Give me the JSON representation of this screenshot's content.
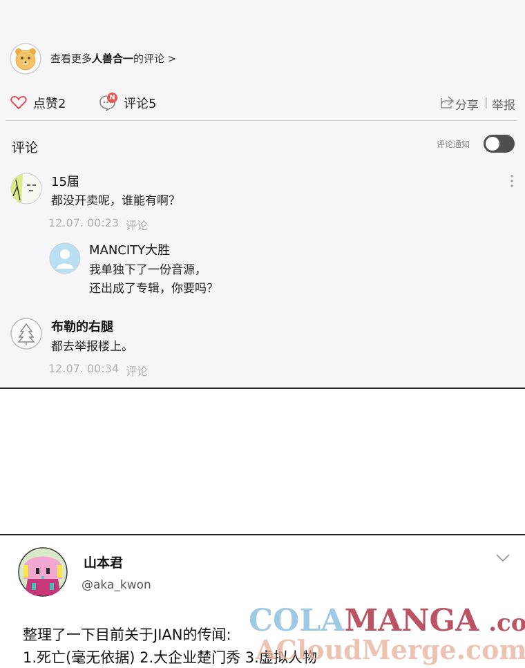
{
  "more_link": {
    "prefix": "查看更多",
    "bold": "人兽合一",
    "suffix": "的评论 >"
  },
  "actions": {
    "like_label": "点赞2",
    "comment_label": "评论5",
    "new_badge": "N",
    "share_label": "分享",
    "divider": "|",
    "report_label": "举报"
  },
  "comments_header": {
    "title": "评论",
    "notify_label": "评论通知"
  },
  "comments": [
    {
      "user": "15届",
      "text": "都没开卖呢，谁能有啊？",
      "time": "12.07. 00:23",
      "reply_label": "评论"
    },
    {
      "user": "布勒的右腿",
      "text": "都去举报楼上。",
      "time": "12.07. 00:34",
      "reply_label": "评论"
    }
  ],
  "reply": {
    "user": "MANCITY大胜",
    "line1": "我单独下了一份音源，",
    "line2": "还出成了专辑，你要吗？"
  },
  "tweet": {
    "name": "山本君",
    "handle": "@aka_kwon",
    "line1": "整理了一下目前关于JIAN的传闻:",
    "line2": "1.死亡(毫无依据) 2.大企业楚门秀 3.虚拟人物"
  },
  "watermark": {
    "part1": "COLA",
    "part2": "MANGA",
    "part3": ".com",
    "line2": "ACloudMerge.com"
  },
  "colors": {
    "heart": "#e0505a",
    "badge": "#e8554e",
    "bear": "#f2c268",
    "toggle": "#4e4e4e"
  }
}
